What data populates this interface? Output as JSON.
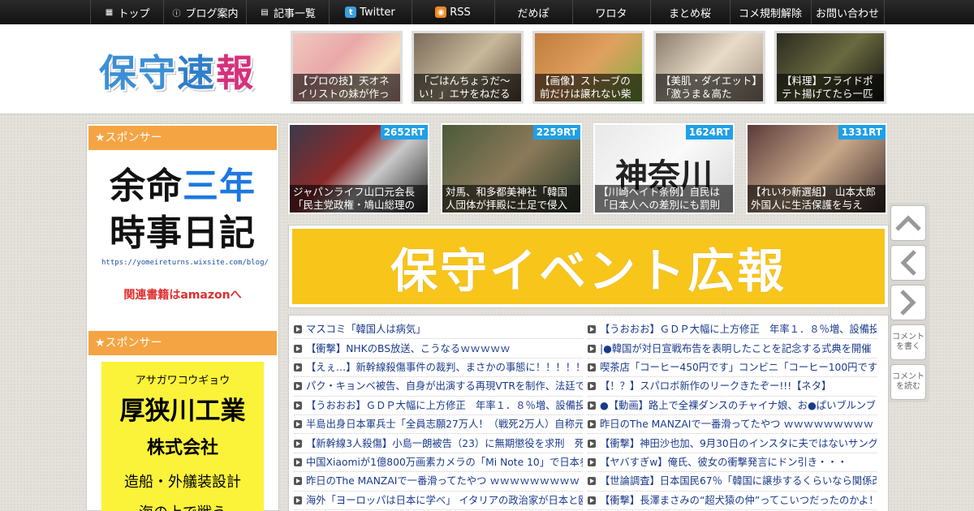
{
  "nav": {
    "items": [
      {
        "label": "トップ",
        "icon": "home-icon",
        "glyph": "▦",
        "width": 90
      },
      {
        "label": "ブログ案内",
        "icon": "info-icon",
        "glyph": "ⓘ",
        "width": 102
      },
      {
        "label": "記事一覧",
        "icon": "list-icon",
        "glyph": "▤",
        "width": 102
      },
      {
        "label": "Twitter",
        "icon": "twitter-icon",
        "glyph": "t",
        "width": 102
      },
      {
        "label": "RSS",
        "icon": "rss-icon",
        "glyph": "◉",
        "width": 102
      },
      {
        "label": "だめぽ",
        "icon": "",
        "glyph": "",
        "width": 96
      },
      {
        "label": "ワロタ",
        "icon": "",
        "glyph": "",
        "width": 96
      },
      {
        "label": "まとめ桜",
        "icon": "",
        "glyph": "",
        "width": 98
      },
      {
        "label": "コメ規制解除",
        "icon": "",
        "glyph": "",
        "width": 100
      },
      {
        "label": "お問い合わせ",
        "icon": "",
        "glyph": "",
        "width": 90
      }
    ]
  },
  "header": {
    "logo": [
      "保",
      "守",
      "速",
      "報"
    ],
    "thumbs": [
      {
        "caption": "【プロの技】天オネイリストの妹が作っ",
        "bg": "linear-gradient(135deg,#f0c8c0,#e9a8a8 40%,#f6e1c0 70%,#d49a9a)"
      },
      {
        "caption": "「ごはんちょうだ～い！」エサをねだる",
        "bg": "linear-gradient(135deg,#7a6a5a,#c8b89a 50%,#5a4a3a)"
      },
      {
        "caption": "【画像】ストーブの前だけは譲れない柴",
        "bg": "linear-gradient(135deg,#c07c3c,#e0a060 50%,#7ab040)"
      },
      {
        "caption": "【美肌・ダイエット】「激うま＆高た",
        "bg": "linear-gradient(135deg,#8a7a6a,#e8dcc8 50%,#a09080)"
      },
      {
        "caption": "【料理】フライドポテト揚げてたら一匹",
        "bg": "linear-gradient(135deg,#2a2a20,#6a6a40 50%,#111)"
      }
    ]
  },
  "sidebar": {
    "sponsor_label": "★スポンサー",
    "ad1": {
      "line1_a": "余命",
      "line1_b": "三年",
      "line2": "時事日記",
      "url": "https://yomeireturns.wixsite.com/blog/",
      "amazon": "関連書籍はamazonへ"
    },
    "ad2": {
      "kana": "アサガワコウギョウ",
      "name": "厚狭川工業",
      "corp": "株式会社",
      "biz": "造船・外艤装設計",
      "tail": "海の上で戦う"
    }
  },
  "rt_items": [
    {
      "count": "2652RT",
      "caption": "ジャパンライフ山口元会長「民主党政権・鳩山総理の",
      "bg": "linear-gradient(135deg,#3a3a4a,#8a2a2a 40%,#c8c8c8 60%,#222)"
    },
    {
      "count": "2259RT",
      "caption": "対馬、和多都美神社「韓国人団体が拝殿に土足で侵入",
      "bg": "linear-gradient(135deg,#4a5a3a,#8a7a5a 50%,#2a3a2a)"
    },
    {
      "count": "1624RT",
      "caption": "【川崎ヘイト条例】自民は「日本人への差別にも罰則",
      "bg": "linear-gradient(135deg,#e8e8e8,#fafafa 50%,#d8d8d8)"
    },
    {
      "count": "1331RT",
      "caption": "【れいわ新選組】 山本太郎外国人に生活保護を与え",
      "bg": "linear-gradient(135deg,#5a3a3a,#c8a88a 50%,#3a2a2a)"
    }
  ],
  "rt_big_text": "神奈川",
  "banner": "保守イベント広報",
  "list_left": [
    "マスコミ「韓国人は病気」",
    "【衝撃】NHKのBS放送、こうなるｗｗｗｗｗ",
    "【えぇ…】新幹線殺傷事件の裁判、まさかの事態に！！！！！",
    "パク・キョンベ被告、自身が出演する再現VTRを制作、法廷で",
    "【うおおお】ＧＤＰ大幅に上方修正　年率１．８％増、設備投",
    "半島出身日本軍兵士「全員志願27万人！（戦死2万人）自称元徴",
    "【新幹線3人殺傷】小島一朗被告（23）に無期懲役を求刑　死刑",
    "中国Xiaomiが1億800万画素カメラの「Mi Note 10」で日本参入",
    "昨日のThe MANZAIで一番滑ってたやつ ｗｗｗｗｗｗｗｗｗ",
    "海外「ヨーロッパは日本に学べ」 イタリアの政治家が日本と欧"
  ],
  "list_right": [
    "【うおおお】ＧＤＰ大幅に上方修正　年率１．８％増、設備投",
    "|●韓国が対日宣戦布告を表明したことを記念する式典を開催",
    "喫茶店「コーヒー450円です」コンビニ「コーヒー100円です」",
    "【！？】スパロボ新作のリークきたぞー!!!【ネタ】",
    "●【動画】路上で全裸ダンスのチャイナ娘、お●ぱいブルンブル",
    "昨日のThe MANZAIで一番滑ってたやつ ｗｗｗｗｗｗｗｗｗ",
    "【衝撃】神田沙也加、9月30日のインスタに夫ではないサングラ",
    "【ヤバすぎw】俺氏、彼女の衝撃発言にドン引き・・・",
    "【世論調査】日本国民67％「韓国に譲歩するくらいなら関係改",
    "【衝撃】長澤まさみの“超犬猿の仲”ってこいつだったのかよ！"
  ],
  "side_buttons": {
    "comment_write": "コメントを書く",
    "comment_read": "コメントを読む"
  }
}
